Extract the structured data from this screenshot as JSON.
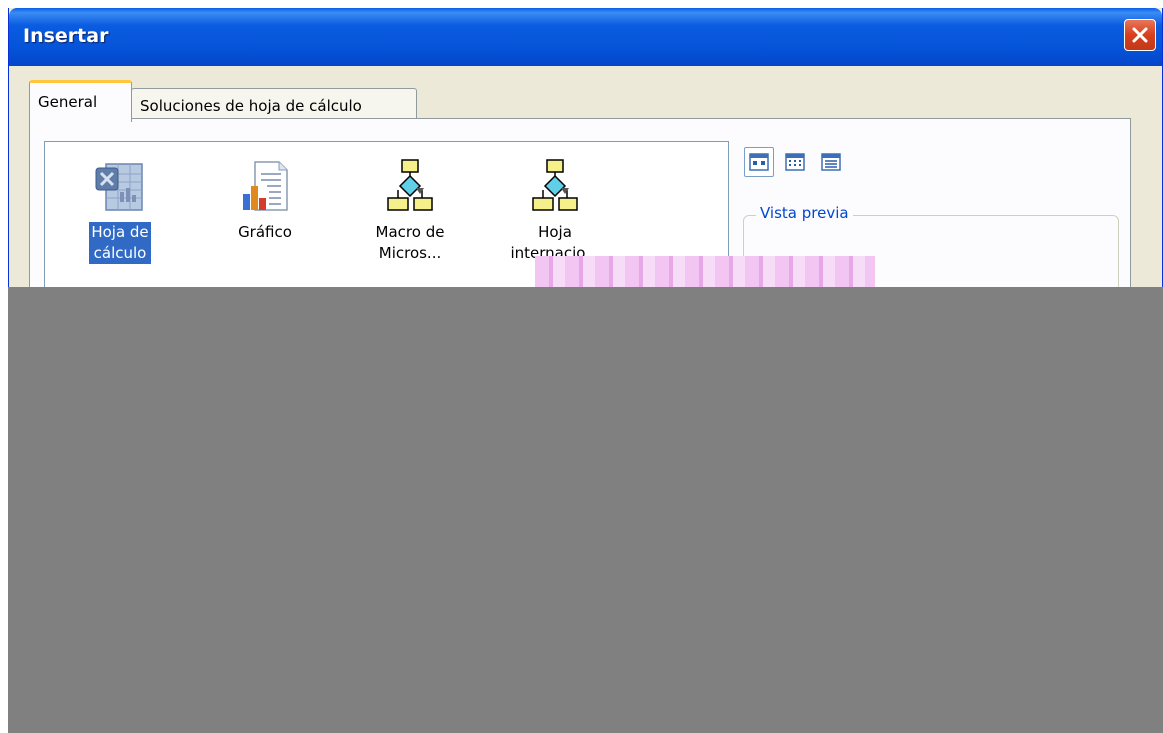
{
  "window": {
    "title": "Insertar"
  },
  "tabs": [
    {
      "label": "General",
      "active": true
    },
    {
      "label": "Soluciones de hoja de cálculo",
      "active": false
    }
  ],
  "items": [
    {
      "label": "Hoja de\ncálculo",
      "icon": "excel-sheet-icon",
      "selected": true
    },
    {
      "label": "Gráfico",
      "icon": "chart-document-icon",
      "selected": false
    },
    {
      "label": "Macro de\nMicros...",
      "icon": "macro-hierarchy-icon",
      "selected": false
    },
    {
      "label": "Hoja\ninternacio...",
      "icon": "macro-hierarchy-icon",
      "selected": false
    }
  ],
  "view_buttons": [
    {
      "icon": "large-icons-view-icon",
      "active": true
    },
    {
      "icon": "list-view-icon",
      "active": false
    },
    {
      "icon": "details-view-icon",
      "active": false
    }
  ],
  "preview": {
    "title": "Vista previa"
  },
  "colors": {
    "titlebar": "#0553d8",
    "dialog_bg": "#ece9d8",
    "selection": "#316ac5",
    "close_button": "#d6401c",
    "groupbox_title": "#0046d5",
    "redaction": "#808080"
  }
}
